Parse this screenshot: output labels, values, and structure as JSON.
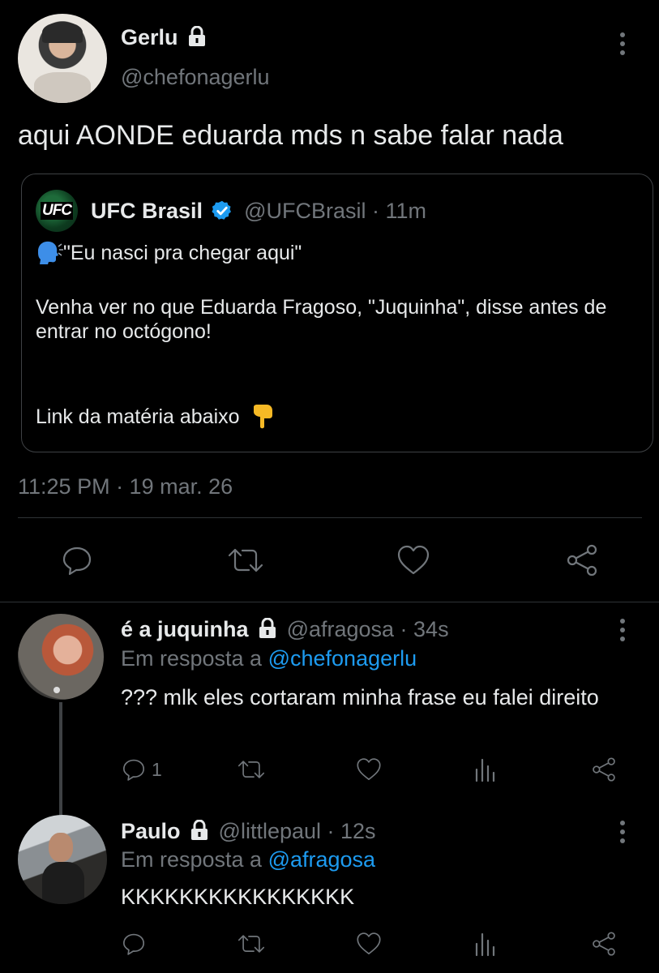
{
  "main_tweet": {
    "display_name": "Gerlu",
    "handle": "@chefonagerlu",
    "text": "aqui AONDE eduarda mds n sabe falar nada",
    "timestamp": "11:25 PM · 19 mar. 26",
    "quoted": {
      "display_name": "UFC Brasil",
      "handle_time": "@UFCBrasil · 11m",
      "logo_text": "UFC",
      "line1": "\"Eu nasci pra chegar aqui\"",
      "line2": "Venha ver no que Eduarda Fragoso, \"Juquinha\", disse antes de entrar no octógono!",
      "line3": "Link da matéria abaixo"
    }
  },
  "replies": [
    {
      "display_name": "é a juquinha",
      "handle_time": "@afragosa · 34s",
      "reply_prefix": "Em resposta a",
      "reply_to": "@chefonagerlu",
      "text": "??? mlk eles cortaram minha frase eu falei direito",
      "reply_count": "1"
    },
    {
      "display_name": "Paulo",
      "handle_time": "@littlepaul · 12s",
      "reply_prefix": "Em resposta a",
      "reply_to": "@afragosa",
      "text": "KKKKKKKKKKKKKKKK",
      "reply_count": ""
    }
  ],
  "colors": {
    "background": "#000000",
    "text": "#e7e9ea",
    "muted": "#71767b",
    "link": "#1d9bf0",
    "divider": "#2f3336"
  }
}
